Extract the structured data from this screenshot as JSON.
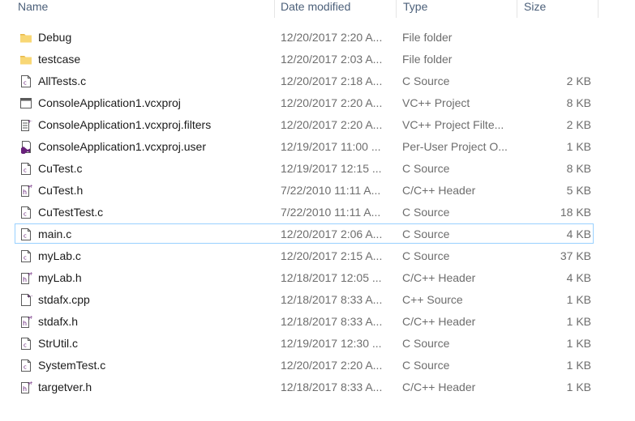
{
  "columns": {
    "name": "Name",
    "date": "Date modified",
    "type": "Type",
    "size": "Size"
  },
  "files": [
    {
      "name": "Debug",
      "date": "12/20/2017 2:20 A...",
      "type": "File folder",
      "size": "",
      "icon": "folder-icon"
    },
    {
      "name": "testcase",
      "date": "12/20/2017 2:03 A...",
      "type": "File folder",
      "size": "",
      "icon": "folder-icon"
    },
    {
      "name": "AllTests.c",
      "date": "12/20/2017 2:18 A...",
      "type": "C Source",
      "size": "2 KB",
      "icon": "c-source-icon"
    },
    {
      "name": "ConsoleApplication1.vcxproj",
      "date": "12/20/2017 2:20 A...",
      "type": "VC++ Project",
      "size": "8 KB",
      "icon": "vc-project-icon"
    },
    {
      "name": "ConsoleApplication1.vcxproj.filters",
      "date": "12/20/2017 2:20 A...",
      "type": "VC++ Project Filte...",
      "size": "2 KB",
      "icon": "project-filters-icon"
    },
    {
      "name": "ConsoleApplication1.vcxproj.user",
      "date": "12/19/2017 11:00 ...",
      "type": "Per-User Project O...",
      "size": "1 KB",
      "icon": "visual-studio-icon"
    },
    {
      "name": "CuTest.c",
      "date": "12/19/2017 12:15 ...",
      "type": "C Source",
      "size": "8 KB",
      "icon": "c-source-icon"
    },
    {
      "name": "CuTest.h",
      "date": "7/22/2010 11:11 A...",
      "type": "C/C++ Header",
      "size": "5 KB",
      "icon": "header-icon"
    },
    {
      "name": "CuTestTest.c",
      "date": "7/22/2010 11:11 A...",
      "type": "C Source",
      "size": "18 KB",
      "icon": "c-source-icon"
    },
    {
      "name": "main.c",
      "date": "12/20/2017 2:06 A...",
      "type": "C Source",
      "size": "4 KB",
      "icon": "c-source-icon"
    },
    {
      "name": "myLab.c",
      "date": "12/20/2017 2:15 A...",
      "type": "C Source",
      "size": "37 KB",
      "icon": "c-source-icon"
    },
    {
      "name": "myLab.h",
      "date": "12/18/2017 12:05 ...",
      "type": "C/C++ Header",
      "size": "4 KB",
      "icon": "header-icon"
    },
    {
      "name": "stdafx.cpp",
      "date": "12/18/2017 8:33 A...",
      "type": "C++ Source",
      "size": "1 KB",
      "icon": "cpp-source-icon"
    },
    {
      "name": "stdafx.h",
      "date": "12/18/2017 8:33 A...",
      "type": "C/C++ Header",
      "size": "1 KB",
      "icon": "header-icon"
    },
    {
      "name": "StrUtil.c",
      "date": "12/19/2017 12:30 ...",
      "type": "C Source",
      "size": "1 KB",
      "icon": "c-source-icon"
    },
    {
      "name": "SystemTest.c",
      "date": "12/20/2017 2:20 A...",
      "type": "C Source",
      "size": "1 KB",
      "icon": "c-source-icon"
    },
    {
      "name": "targetver.h",
      "date": "12/18/2017 8:33 A...",
      "type": "C/C++ Header",
      "size": "1 KB",
      "icon": "header-icon"
    }
  ],
  "focused_file": "main.c",
  "colors": {
    "folder": "#f8d775",
    "folder_dark": "#e8b84a",
    "accent_purple": "#68217a",
    "focus_border": "#99d1ff"
  }
}
